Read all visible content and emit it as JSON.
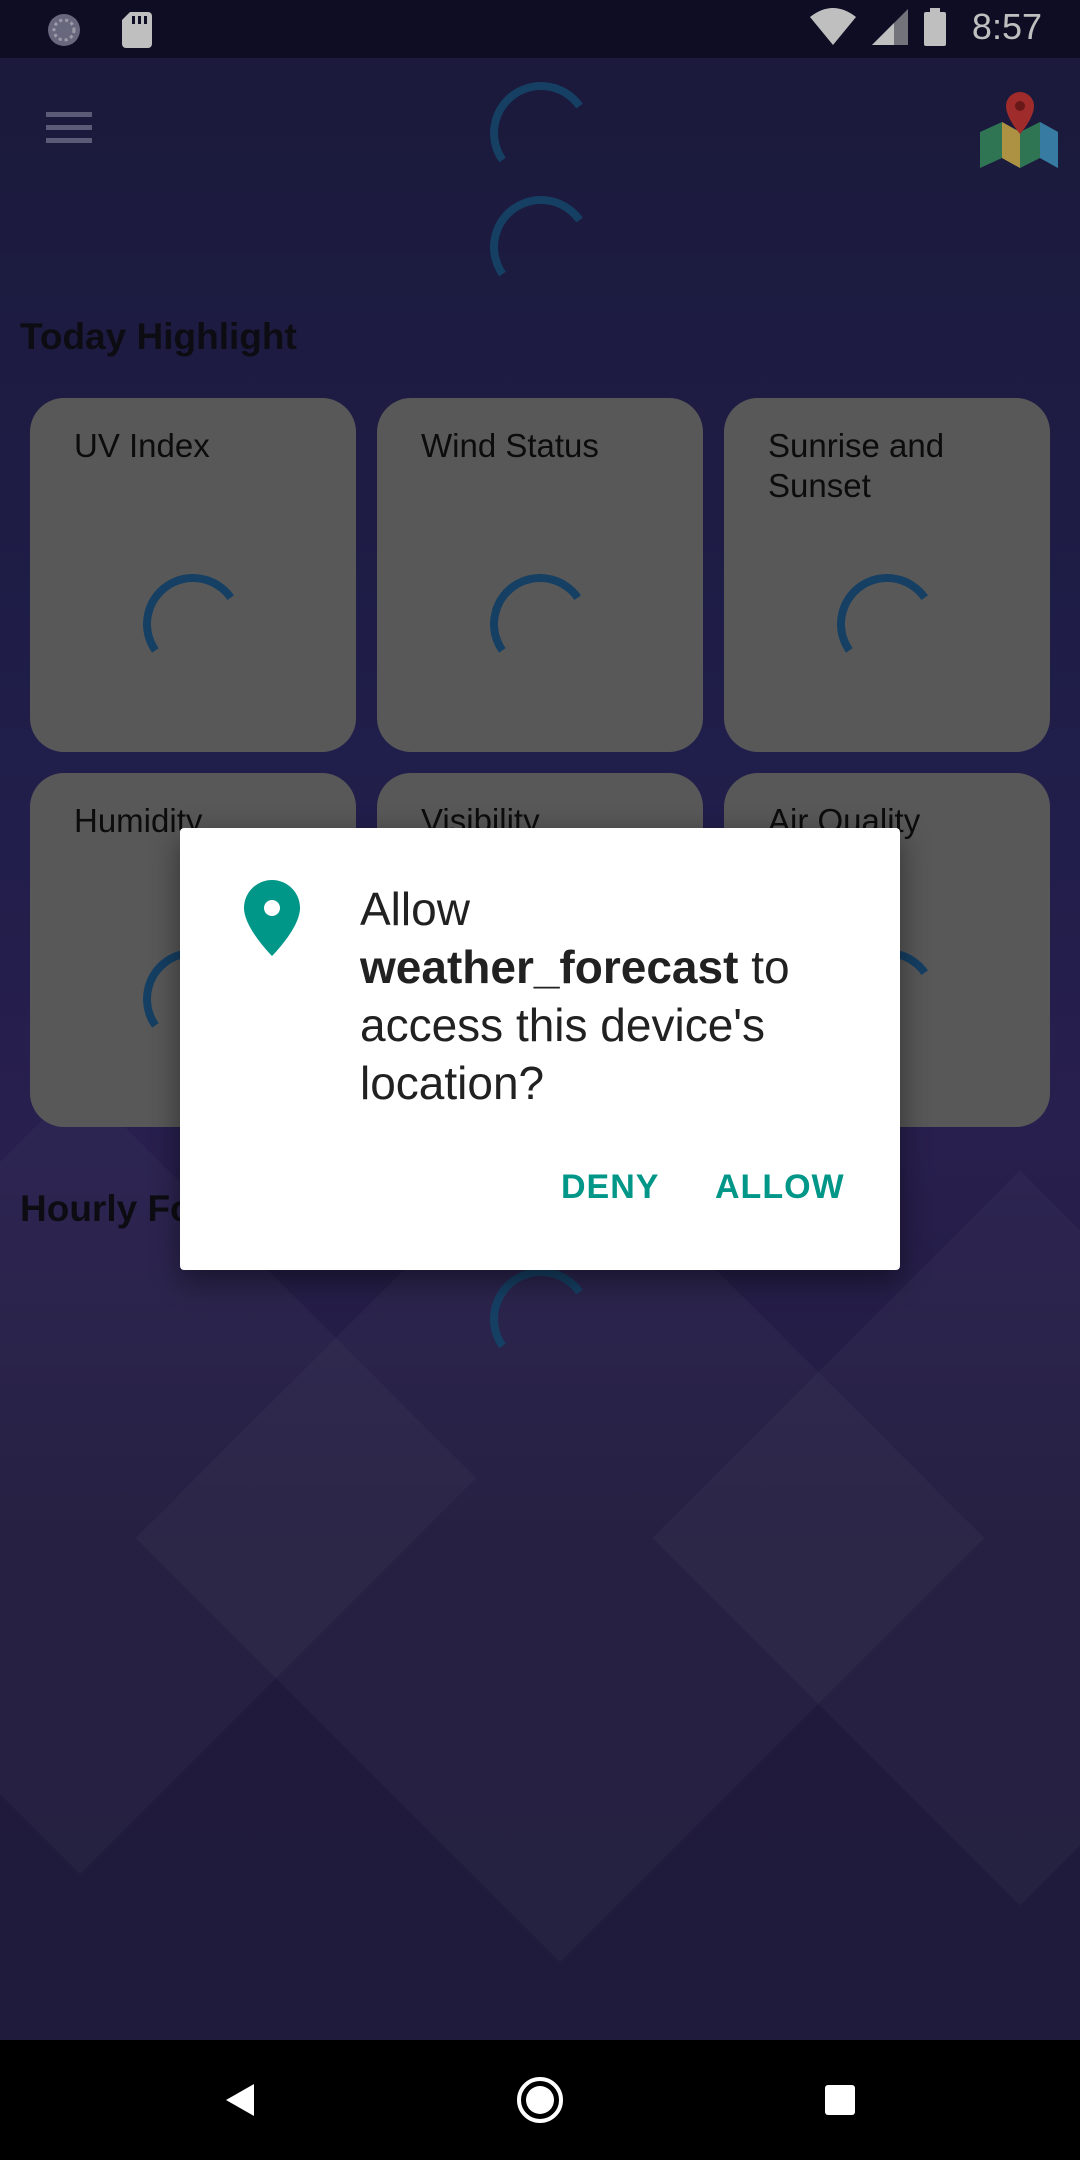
{
  "status_bar": {
    "time": "8:57",
    "icons": [
      "sync-icon",
      "sd-card-icon",
      "wifi-icon",
      "cell-signal-icon",
      "battery-icon"
    ]
  },
  "app_bar": {
    "menu_icon": "hamburger-menu-icon",
    "map_icon": "map-location-icon"
  },
  "today_highlight": {
    "title": "Today Highlight",
    "cards": [
      {
        "label": "UV Index"
      },
      {
        "label": "Wind Status"
      },
      {
        "label": "Sunrise and Sunset"
      },
      {
        "label": "Humidity"
      },
      {
        "label": "Visibility"
      },
      {
        "label": "Air Quality"
      }
    ]
  },
  "hourly_forecast": {
    "title": "Hourly Forecast"
  },
  "permission_dialog": {
    "icon": "location-pin-icon",
    "prefix": "Allow",
    "app_name": "weather_forecast",
    "suffix": "to access this device's location?",
    "deny_label": "DENY",
    "allow_label": "ALLOW"
  },
  "nav_bar": {
    "back_icon": "back-triangle-icon",
    "home_icon": "home-circle-icon",
    "recents_icon": "recents-square-icon"
  },
  "colors": {
    "accent": "#009688",
    "spinner": "#1d5585",
    "card": "#767676"
  }
}
